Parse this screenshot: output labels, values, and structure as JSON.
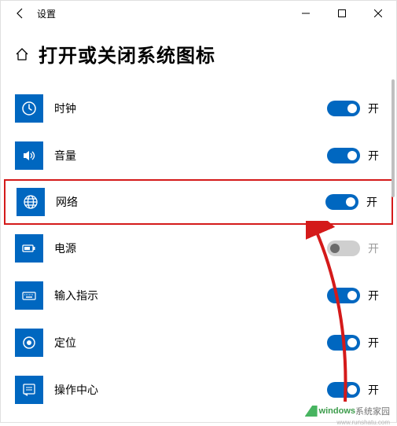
{
  "titlebar": {
    "title": "设置"
  },
  "header": {
    "title": "打开或关闭系统图标"
  },
  "rows": [
    {
      "icon": "clock",
      "label": "时钟",
      "on": true,
      "state": "开",
      "highlight": false
    },
    {
      "icon": "volume",
      "label": "音量",
      "on": true,
      "state": "开",
      "highlight": false
    },
    {
      "icon": "network",
      "label": "网络",
      "on": true,
      "state": "开",
      "highlight": true
    },
    {
      "icon": "power",
      "label": "电源",
      "on": false,
      "state": "开",
      "highlight": false,
      "disabled": true
    },
    {
      "icon": "input",
      "label": "输入指示",
      "on": true,
      "state": "开",
      "highlight": false
    },
    {
      "icon": "location",
      "label": "定位",
      "on": true,
      "state": "开",
      "highlight": false
    },
    {
      "icon": "action",
      "label": "操作中心",
      "on": true,
      "state": "开",
      "highlight": false,
      "partial": true
    }
  ],
  "watermark": {
    "brand1": "windows",
    "brand2": "系统家园",
    "url": "www.runshatu.com"
  }
}
